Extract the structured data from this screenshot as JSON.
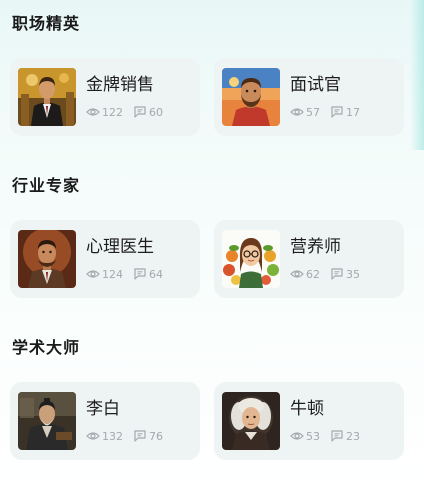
{
  "sections": [
    {
      "title": "职场精英",
      "cards": [
        {
          "name": "金牌销售",
          "views": "122",
          "comments": "60",
          "avatar_icon": "salesman-portrait-icon"
        },
        {
          "name": "面试官",
          "views": "57",
          "comments": "17",
          "avatar_icon": "interviewer-portrait-icon"
        }
      ]
    },
    {
      "title": "行业专家",
      "cards": [
        {
          "name": "心理医生",
          "views": "124",
          "comments": "64",
          "avatar_icon": "psychologist-portrait-icon"
        },
        {
          "name": "营养师",
          "views": "62",
          "comments": "35",
          "avatar_icon": "nutritionist-portrait-icon"
        }
      ]
    },
    {
      "title": "学术大师",
      "cards": [
        {
          "name": "李白",
          "views": "132",
          "comments": "76",
          "avatar_icon": "li-bai-portrait-icon"
        },
        {
          "name": "牛顿",
          "views": "53",
          "comments": "23",
          "avatar_icon": "newton-portrait-icon"
        }
      ]
    }
  ],
  "colors": {
    "card_bg": "#eef3f4",
    "stat_text": "#a3a9ad",
    "title_text": "#1a1a1a"
  }
}
